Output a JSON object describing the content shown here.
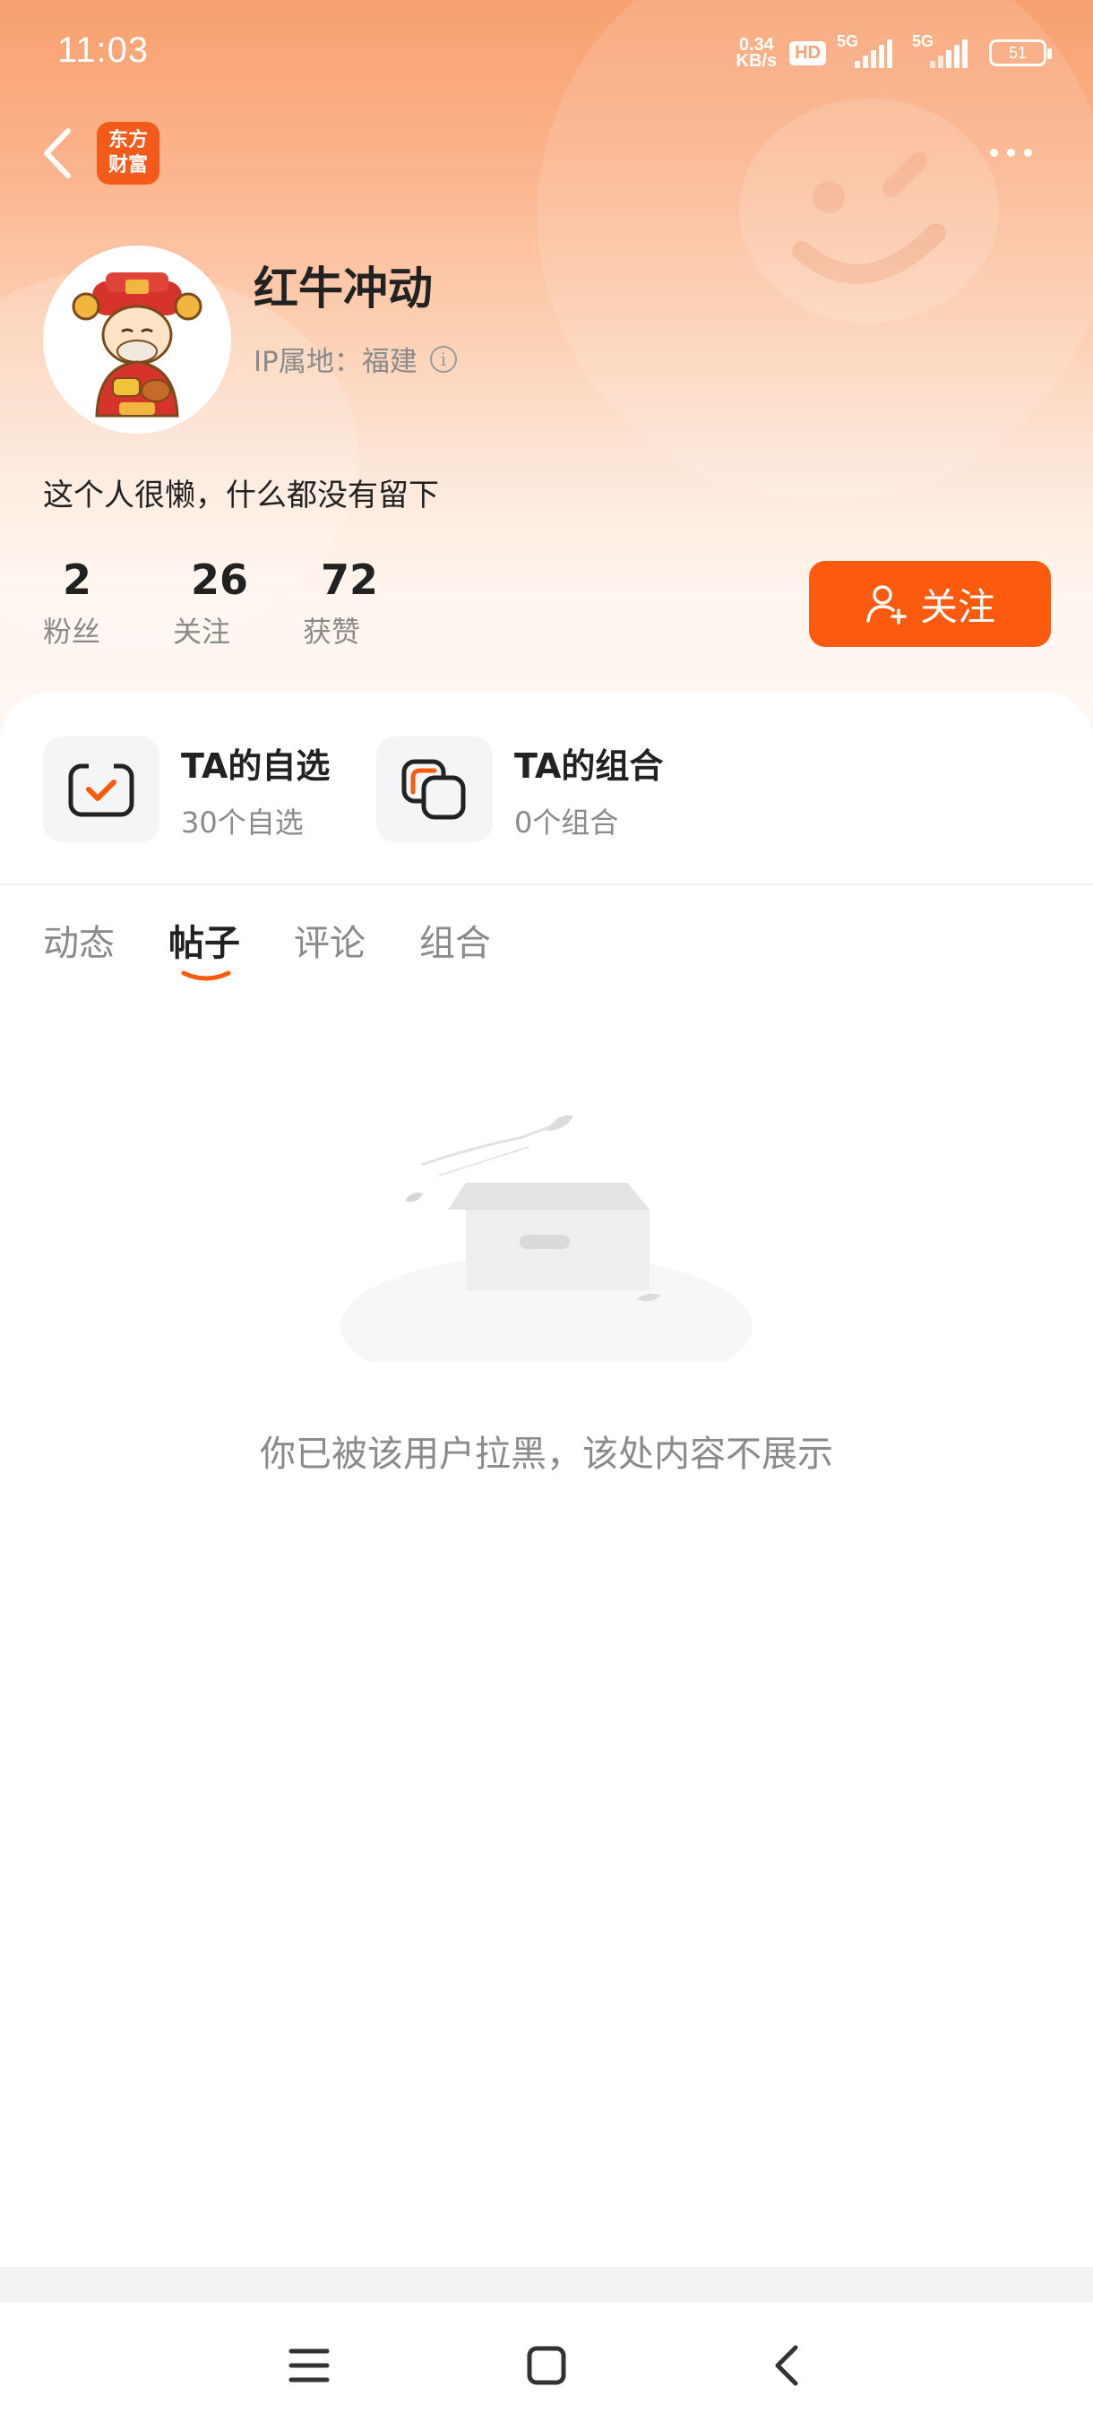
{
  "status_bar": {
    "time": "11:03",
    "net_speed_value": "0.34",
    "net_speed_unit": "KB/s",
    "hd_label": "HD",
    "signal1_label": "5G",
    "signal2_label": "5G",
    "battery": "51"
  },
  "header": {
    "app_logo_line1": "东方",
    "app_logo_line2": "财富"
  },
  "profile": {
    "username": "红牛冲动",
    "ip_location": "IP属地：福建",
    "bio": "这个人很懒，什么都没有留下",
    "stats": [
      {
        "value": "2",
        "label": "粉丝"
      },
      {
        "value": "26",
        "label": "关注"
      },
      {
        "value": "72",
        "label": "获赞"
      }
    ],
    "follow_label": "关注"
  },
  "tools": [
    {
      "title": "TA的自选",
      "subtitle": "30个自选"
    },
    {
      "title": "TA的组合",
      "subtitle": "0个组合"
    }
  ],
  "tabs": [
    {
      "label": "动态"
    },
    {
      "label": "帖子"
    },
    {
      "label": "评论"
    },
    {
      "label": "组合"
    }
  ],
  "active_tab": "帖子",
  "empty_state": {
    "message": "你已被该用户拉黑，该处内容不展示"
  },
  "colors": {
    "accent": "#fb5a0f",
    "header_gradient_top": "#f8a070"
  },
  "icons": [
    "back-icon",
    "app-logo",
    "more-icon",
    "info-icon",
    "add-user-icon",
    "watchlist-icon",
    "portfolio-icon",
    "menu-icon",
    "home-icon",
    "nav-back-icon"
  ]
}
